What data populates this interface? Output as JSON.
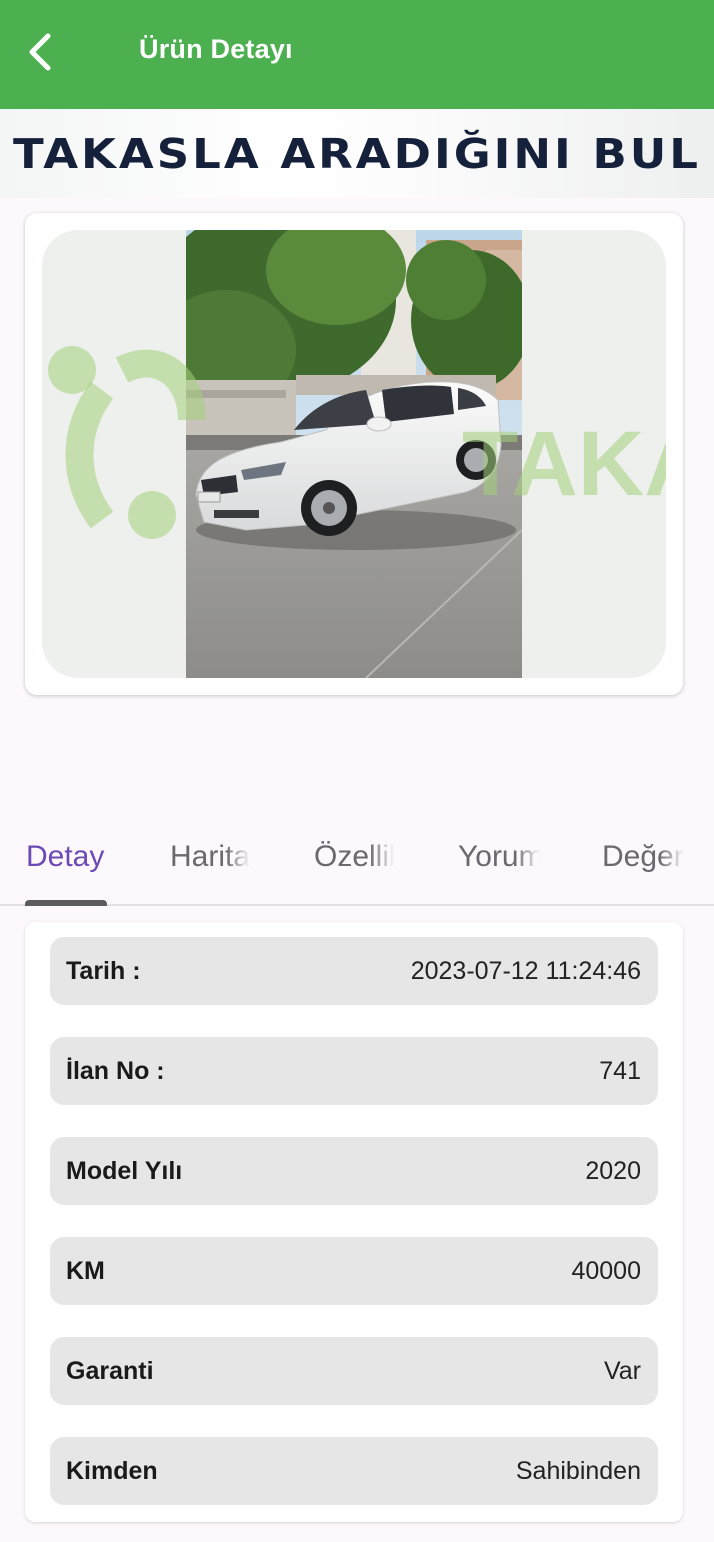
{
  "appbar": {
    "title": "Ürün Detayı",
    "color": "#4caf50",
    "back_icon": "chevron-left-icon"
  },
  "banner": {
    "text": "TAKASLA ARADIĞINI BUL"
  },
  "product_image": {
    "watermark_text": "TAKAS"
  },
  "tabs": [
    {
      "label": "Detay",
      "active": true
    },
    {
      "label": "Harita",
      "active": false
    },
    {
      "label": "Özellikler",
      "active": false
    },
    {
      "label": "Yorumlar",
      "active": false
    },
    {
      "label": "Değerlendirme",
      "active": false
    }
  ],
  "details": [
    {
      "label": "Tarih :",
      "value": "2023-07-12 11:24:46"
    },
    {
      "label": "İlan No :",
      "value": "741"
    },
    {
      "label": "Model Yılı",
      "value": "2020"
    },
    {
      "label": "KM",
      "value": "40000"
    },
    {
      "label": "Garanti",
      "value": "Var"
    },
    {
      "label": "Kimden",
      "value": "Sahibinden"
    }
  ]
}
